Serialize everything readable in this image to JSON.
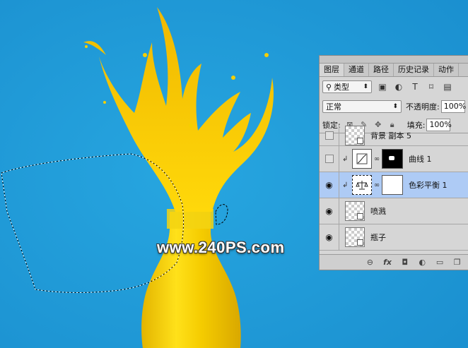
{
  "watermark": "www.240PS.com",
  "panel": {
    "tabs": [
      "图层",
      "通道",
      "路径",
      "历史记录",
      "动作"
    ],
    "filter": {
      "label": "类型"
    },
    "blend": {
      "mode": "正常",
      "opacity_label": "不透明度:",
      "opacity_value": "100%"
    },
    "lock": {
      "label": "锁定:",
      "fill_label": "填充:",
      "fill_value": "100%"
    },
    "layers": [
      {
        "name": "背景 副本 5"
      },
      {
        "name": "曲线 1"
      },
      {
        "name": "色彩平衡 1"
      },
      {
        "name": "喷溅"
      },
      {
        "name": "瓶子"
      }
    ]
  },
  "colors": {
    "background": "#1d9ad6",
    "paint": "#f5cf00",
    "selected_layer": "#aecbf5"
  }
}
